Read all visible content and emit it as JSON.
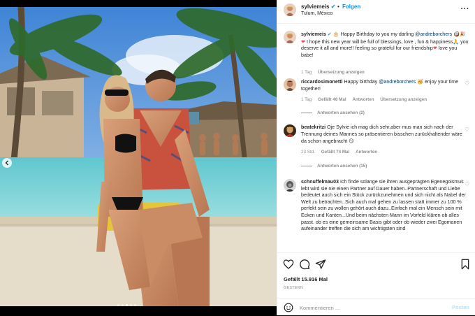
{
  "header": {
    "username": "sylviemeis",
    "verified_glyph": "✔",
    "separator": "•",
    "follow_label": "Folgen",
    "location": "Tulum, México",
    "more_icon": "more-horizontal-icon"
  },
  "media": {
    "carousel_dots": 5,
    "active_dot": 3,
    "prev_icon": "chevron-left-icon"
  },
  "caption": {
    "username": "sylviemeis",
    "verified_glyph": "✔",
    "emoji_a": "🎂",
    "text_1": "Happy Birthday to you my darling",
    "mention": "@andreborchers",
    "emoji_b": "🥥🎉",
    "heart": "❤",
    "text_2": "I hope this new year will be full of blessings, love , fun & happiness",
    "emoji_c": "🙏",
    "text_3": "you deserve it all and more!! feeling so grateful for our friendship",
    "text_4": "love you babe!",
    "time": "1 Tag",
    "translate": "Übersetzung anzeigen"
  },
  "comments": [
    {
      "username": "riccardosimonetti",
      "text_1": "Happy birthday",
      "mention": "@andreborchers",
      "emoji": "🥳",
      "text_2": "enjoy your time together!",
      "time": "1 Tag",
      "likes": "Gefällt 46 Mal",
      "reply": "Antworten",
      "translate": "Übersetzung anzeigen",
      "view_replies": "Antworten ansehen (2)"
    },
    {
      "username": "beatekritzi",
      "text": "Oje Sylvie ich mag dich sehr,aber mus man sich nach der Trennung deines Mannes so präsentieren bisschen zurückhaltender wäre da schon angebracht",
      "emoji": "😏",
      "time": "23 Std.",
      "likes": "Gefällt 74 Mal",
      "reply": "Antworten",
      "view_replies": "Antworten ansehen (15)"
    },
    {
      "username": "schnuffelmau03",
      "text": "Ich finde solange sie ihren ausgeprägten Egenegoismus lebt wird sie nie einen Partner auf Dauer haben..Partnerschaft und Liebe bedeutet auch sich ein Stück zurückzunehmen und sich nicht als Nabel der Welt zu betrachten..Sich auch mal gehen zu lassen statt immer zu 100 % perfekt sein zu wollen gehört auch dazu..Einfach mal ein Mensch sein mit Ecken und Kanten...Und beim nächsten Mann im Vorfeld klären ob alles passt. ob es eine gemeinsame Basis gibt oder ob wieder zwei Egomanen aufeinander treffen die sich am wichtigsten sind"
    }
  ],
  "actions": {
    "like_icon": "heart-icon",
    "comment_icon": "comment-icon",
    "share_icon": "paper-plane-icon",
    "save_icon": "bookmark-icon",
    "likes": "Gefällt 15.916 Mal",
    "date": "GESTERN"
  },
  "add_comment": {
    "placeholder": "Kommentieren ...",
    "post_label": "Posten",
    "emoji_icon": "smiley-icon"
  },
  "colors": {
    "link": "#0095f6",
    "mention": "#00376b",
    "muted": "#8e8e8e",
    "post_disabled": "#b2dffc"
  }
}
